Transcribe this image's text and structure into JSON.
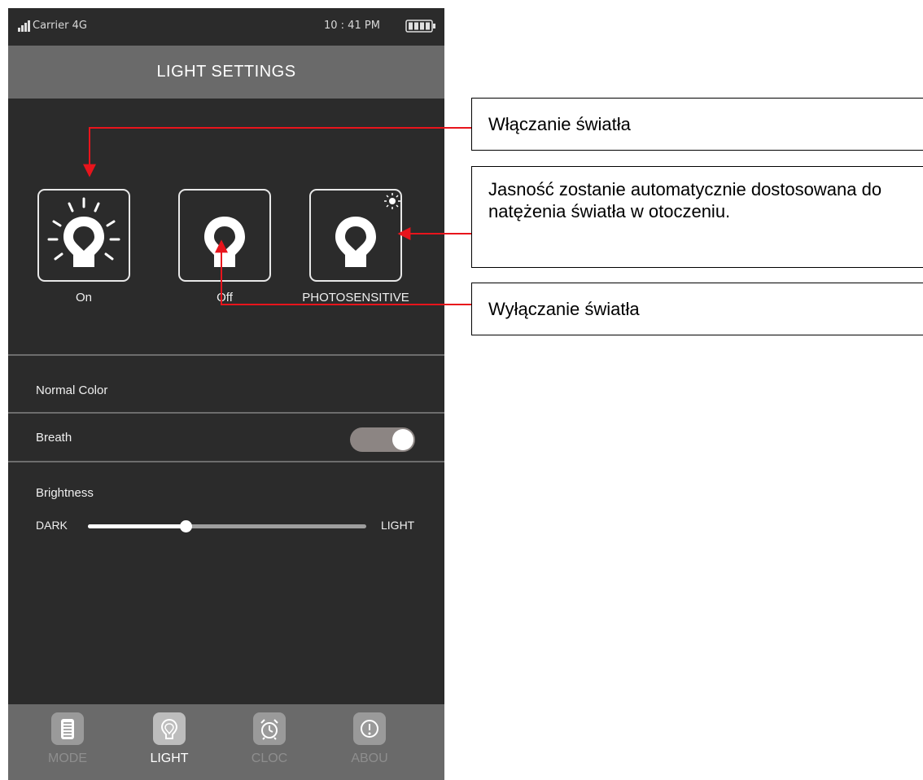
{
  "status_bar": {
    "carrier": "Carrier  4G",
    "time": "10 : 41 PM"
  },
  "title": "LIGHT SETTINGS",
  "modes": [
    {
      "label": "On",
      "icon": "bulb-rays-icon"
    },
    {
      "label": "Off",
      "icon": "bulb-icon"
    },
    {
      "label": "PHOTOSENSITIVE",
      "icon": "bulb-sun-icon"
    }
  ],
  "rows": {
    "normal_color": "Normal Color",
    "breath": "Breath",
    "breath_on": true,
    "brightness": "Brightness"
  },
  "slider": {
    "min_label": "DARK",
    "max_label": "LIGHT",
    "value_fraction": 0.35
  },
  "tabs": [
    {
      "label": "MODE",
      "icon": "list-icon",
      "active": false
    },
    {
      "label": "LIGHT",
      "icon": "bulb-icon",
      "active": true
    },
    {
      "label": "CLOC",
      "icon": "alarm-clock-icon",
      "active": false
    },
    {
      "label": "ABOU",
      "icon": "info-icon",
      "active": false
    }
  ],
  "annotations": {
    "on_text": "Włączanie światła",
    "photo_text": "Jasność zostanie automatycznie dostosowana do natężenia światła w otoczeniu.",
    "off_text": "Wyłączanie światła"
  },
  "colors": {
    "background": "#2b2b2b",
    "title_bar": "#6a6a6a",
    "arrow": "#e8141c",
    "toggle_track": "#8c8583"
  }
}
